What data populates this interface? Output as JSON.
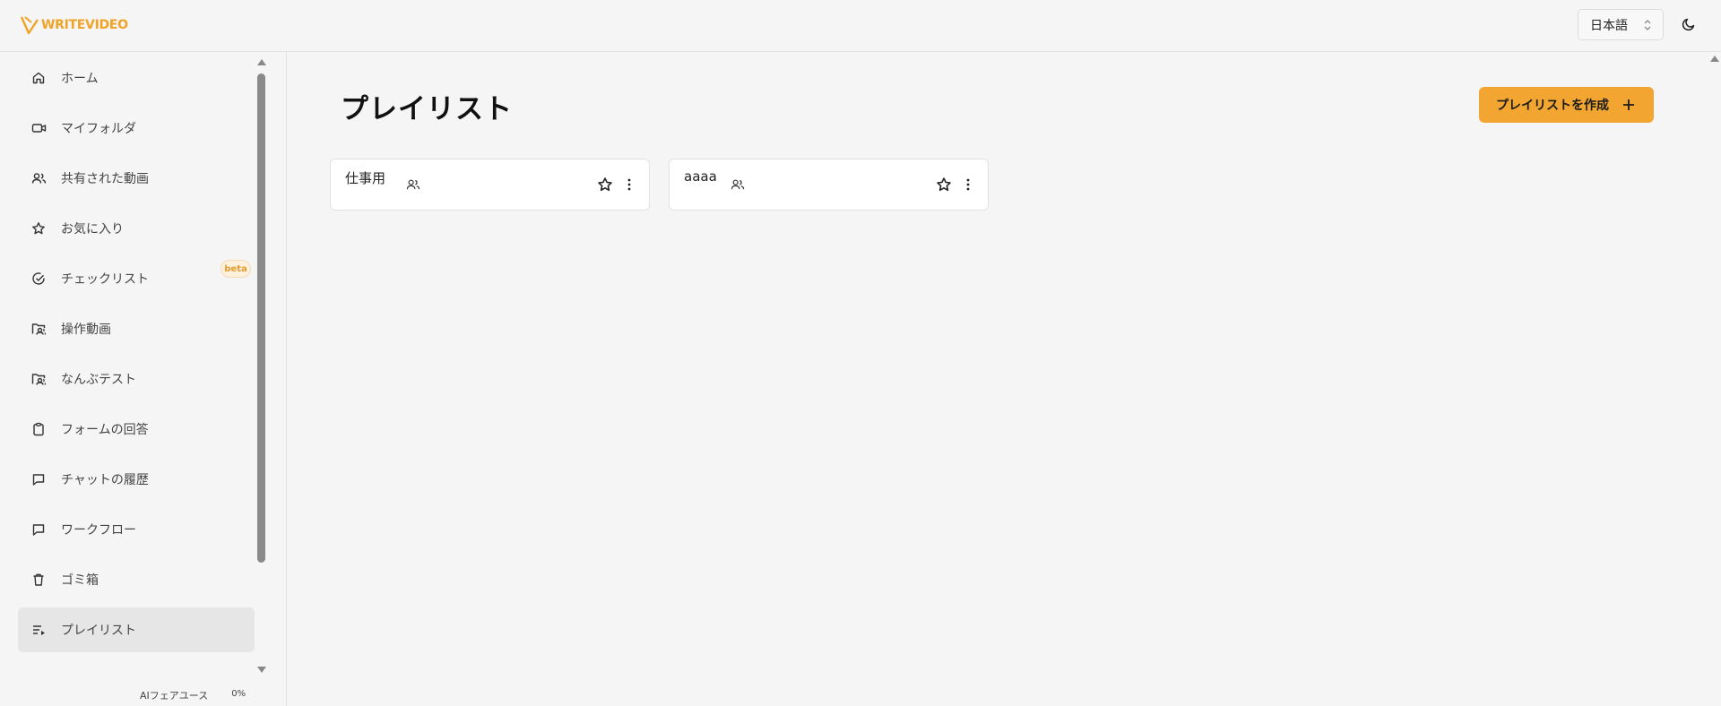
{
  "app": {
    "logo_text": "WRITEVIDEO",
    "brand_color": "#f2a631"
  },
  "header": {
    "language": "日本語",
    "theme_icon": "moon-icon"
  },
  "sidebar": {
    "items": [
      {
        "label": "ホーム",
        "icon": "home-icon"
      },
      {
        "label": "マイフォルダ",
        "icon": "video-icon"
      },
      {
        "label": "共有された動画",
        "icon": "users-icon"
      },
      {
        "label": "お気に入り",
        "icon": "star-icon"
      },
      {
        "label": "チェックリスト",
        "icon": "check-circle-icon"
      },
      {
        "label": "操作動画",
        "icon": "folder-video-icon"
      },
      {
        "label": "なんぶテスト",
        "icon": "folder-video-icon"
      },
      {
        "label": "フォームの回答",
        "icon": "clipboard-icon"
      },
      {
        "label": "チャットの履歴",
        "icon": "message-icon"
      },
      {
        "label": "ワークフロー",
        "icon": "message-icon"
      },
      {
        "label": "ゴミ箱",
        "icon": "trash-icon"
      },
      {
        "label": "プレイリスト",
        "icon": "playlist-icon",
        "active": true
      }
    ],
    "beta_badge": "beta",
    "usage_label": "AIフェアユース",
    "usage_percent": "0%"
  },
  "main": {
    "title": "プレイリスト",
    "create_button": "プレイリストを作成",
    "playlists": [
      {
        "title": "仕事用"
      },
      {
        "title": "aaaa"
      }
    ]
  }
}
